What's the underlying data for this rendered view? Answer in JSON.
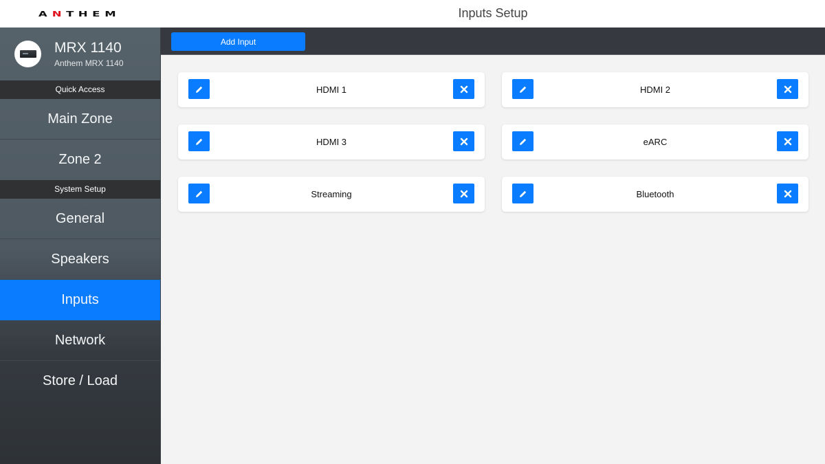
{
  "brand": {
    "logo_letters": [
      "A",
      "N",
      "T",
      "H",
      "E",
      "M"
    ],
    "accent_letter_index": 1,
    "accent_color": "#e0141e"
  },
  "header": {
    "title": "Inputs Setup"
  },
  "device": {
    "name": "MRX 1140",
    "model": "Anthem MRX 1140",
    "icon": "receiver-icon"
  },
  "sidebar": {
    "sections": [
      {
        "label": "Quick Access",
        "items": [
          {
            "label": "Main Zone"
          },
          {
            "label": "Zone 2"
          }
        ]
      },
      {
        "label": "System Setup",
        "items": [
          {
            "label": "General"
          },
          {
            "label": "Speakers"
          },
          {
            "label": "Inputs",
            "active": true
          },
          {
            "label": "Network"
          },
          {
            "label": "Store / Load"
          }
        ]
      }
    ]
  },
  "toolbar": {
    "add_label": "Add Input"
  },
  "inputs": [
    {
      "label": "HDMI 1"
    },
    {
      "label": "HDMI 2"
    },
    {
      "label": "HDMI 3"
    },
    {
      "label": "eARC"
    },
    {
      "label": "Streaming"
    },
    {
      "label": "Bluetooth"
    }
  ],
  "icons": {
    "edit": "pencil-icon",
    "delete": "close-icon"
  },
  "colors": {
    "accent": "#0a7cff",
    "sidebar": "#56626a",
    "toolbar": "#363a40"
  }
}
